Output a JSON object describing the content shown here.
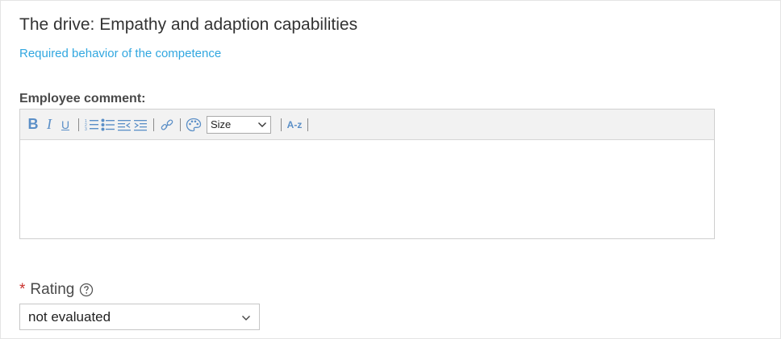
{
  "competence": {
    "title": "The drive: Empathy and adaption capabilities",
    "subtitle_link": "Required behavior of the competence"
  },
  "employee_comment": {
    "label": "Employee comment:",
    "value": "",
    "toolbar": {
      "bold": "B",
      "italic": "I",
      "underline": "U",
      "size_select_value": "Size",
      "az_button": "A-z"
    }
  },
  "rating": {
    "required_marker": "*",
    "label": "Rating",
    "selected_value": "not evaluated"
  },
  "colors": {
    "link": "#31a7e0",
    "toolbar_icon": "#5b8fc7",
    "required": "#c9302c"
  }
}
